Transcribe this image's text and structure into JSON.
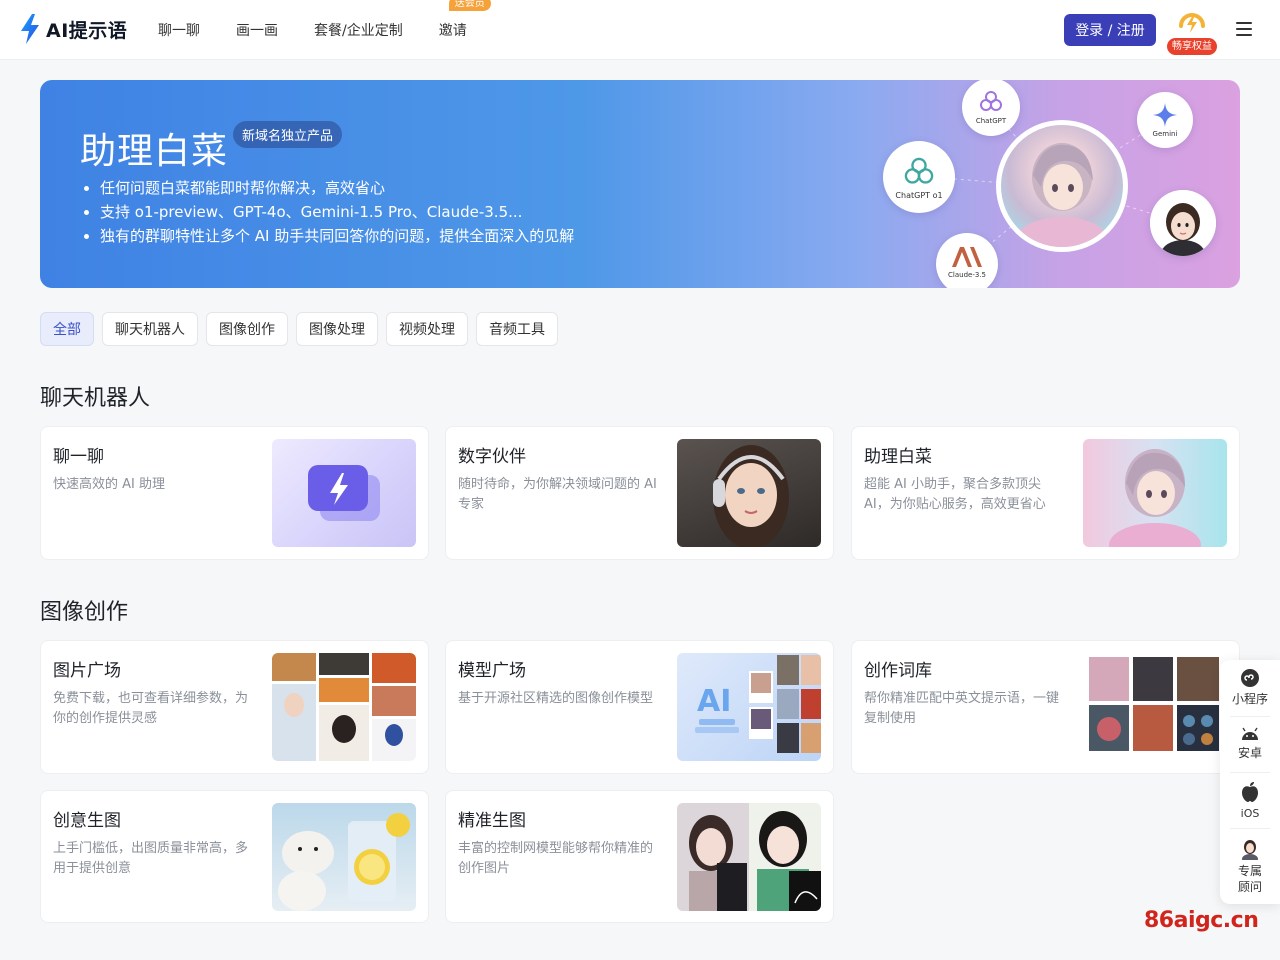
{
  "header": {
    "logo_text": "AI提示语",
    "nav": [
      {
        "label": "聊一聊"
      },
      {
        "label": "画一画"
      },
      {
        "label": "套餐/企业定制"
      },
      {
        "label": "邀请",
        "badge": "送会员"
      }
    ],
    "login_label": "登录 / 注册",
    "vip_label": "畅享权益"
  },
  "banner": {
    "title": "助理白菜",
    "tag": "新域名独立产品",
    "bullets": [
      "任何问题白菜都能即时帮你解决，高效省心",
      "支持 o1-preview、GPT-4o、Gemini-1.5 Pro、Claude-3.5...",
      "独有的群聊特性让多个 AI 助手共同回答你的问题，提供全面深入的见解"
    ],
    "bots": {
      "chatgpt": "ChatGPT",
      "gemini": "Gemini",
      "chatgpt_o1": "ChatGPT o1",
      "claude": "Claude-3.5"
    }
  },
  "filters": [
    "全部",
    "聊天机器人",
    "图像创作",
    "图像处理",
    "视频处理",
    "音频工具"
  ],
  "sections": {
    "chat": {
      "title": "聊天机器人",
      "cards": [
        {
          "title": "聊一聊",
          "desc": "快速高效的 AI 助理"
        },
        {
          "title": "数字伙伴",
          "desc": "随时待命，为你解决领域问题的 AI 专家"
        },
        {
          "title": "助理白菜",
          "desc": "超能 AI 小助手，聚合多款顶尖 AI，为你贴心服务，高效更省心"
        }
      ]
    },
    "image": {
      "title": "图像创作",
      "cards": [
        {
          "title": "图片广场",
          "desc": "免费下载，也可查看详细参数，为你的创作提供灵感"
        },
        {
          "title": "模型广场",
          "desc": "基于开源社区精选的图像创作模型"
        },
        {
          "title": "创作词库",
          "desc": "帮你精准匹配中英文提示语，一键复制使用"
        },
        {
          "title": "创意生图",
          "desc": "上手门槛低，出图质量非常高，多用于提供创意"
        },
        {
          "title": "精准生图",
          "desc": "丰富的控制网模型能够帮你精准的创作图片"
        }
      ]
    }
  },
  "dock": [
    {
      "label": "小程序",
      "icon": "mini-program-icon"
    },
    {
      "label": "安卓",
      "icon": "android-icon"
    },
    {
      "label": "iOS",
      "icon": "apple-icon"
    },
    {
      "label": "专属\n顾问",
      "icon": "advisor-avatar-icon"
    }
  ],
  "watermark": "86aigc.cn",
  "colors": {
    "primary": "#3a3fb8",
    "filter_active": "#3a52c8",
    "vip_red": "#e8412c",
    "badge_orange": "#f6a23a",
    "watermark_red": "#d0241c"
  }
}
